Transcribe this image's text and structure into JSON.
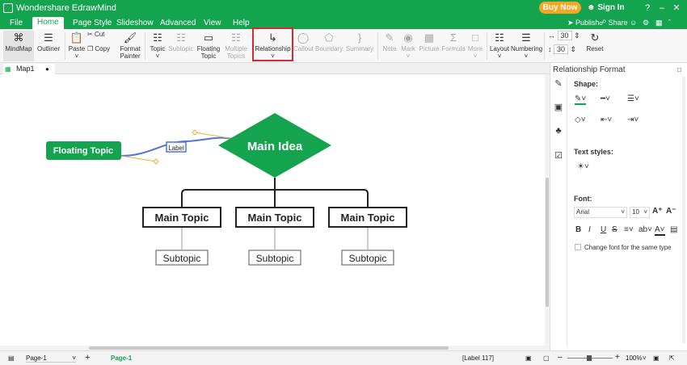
{
  "app": {
    "title": "Wondershare EdrawMind",
    "buy_now": "Buy Now",
    "sign_in": "Sign In",
    "publish": "Publish",
    "share": "Share"
  },
  "menu": [
    {
      "label": "File"
    },
    {
      "label": "Home"
    },
    {
      "label": "Page Style"
    },
    {
      "label": "Slideshow"
    },
    {
      "label": "Advanced"
    },
    {
      "label": "View"
    },
    {
      "label": "Help"
    }
  ],
  "ribbon": {
    "mindmap": "MindMap",
    "outliner": "Outliner",
    "paste": "Paste",
    "cut": "Cut",
    "copy": "Copy",
    "format_painter_1": "Format",
    "format_painter_2": "Painter",
    "topic": "Topic",
    "subtopic": "Subtopic",
    "floating_topic_1": "Floating",
    "floating_topic_2": "Topic",
    "multiple_topics_1": "Multiple",
    "multiple_topics_2": "Topics",
    "relationship": "Relationship",
    "callout": "Callout",
    "boundary": "Boundary",
    "summary": "Summary",
    "note": "Note",
    "mark": "Mark",
    "picture": "Picture",
    "formula": "Formula",
    "more": "More",
    "layout": "Layout",
    "numbering": "Numbering",
    "spacing_h": "30",
    "spacing_v": "30",
    "reset": "Reset"
  },
  "doc_tab": "Map1",
  "mindmap": {
    "floating_topic": "Floating Topic",
    "relationship_label": "Label",
    "main_idea": "Main Idea",
    "main_topics": [
      "Main Topic",
      "Main Topic",
      "Main Topic"
    ],
    "subtopics": [
      "Subtopic",
      "Subtopic",
      "Subtopic"
    ]
  },
  "panel": {
    "title": "Relationship Format",
    "shape": "Shape:",
    "text_styles": "Text styles:",
    "font": "Font:",
    "font_family": "Arial",
    "font_size": "10",
    "change_font_label": "Change font for the same type"
  },
  "status": {
    "page_select": "Page-1",
    "page_tab": "Page-1",
    "selection": "[Label 117]",
    "zoom": "100%"
  },
  "colors": {
    "brand": "#14a34e",
    "highlight": "#d9272e",
    "relationship": "#4f74d9",
    "buy_now": "#f5a623"
  }
}
